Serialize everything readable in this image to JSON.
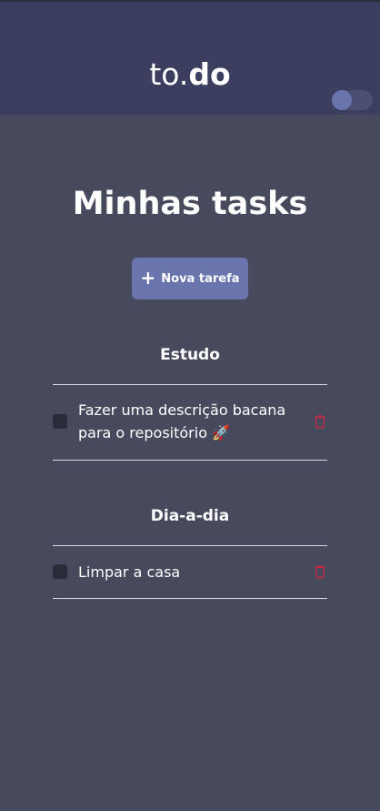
{
  "app": {
    "logo_light": "to.",
    "logo_bold": "do"
  },
  "theme_toggle": {
    "state": "on"
  },
  "page_title": "Minhas tasks",
  "new_task_button": {
    "icon": "plus-icon",
    "label": "Nova tarefa"
  },
  "sections": [
    {
      "title": "Estudo",
      "tasks": [
        {
          "text": "Fazer uma descrição bacana para o repositório 🚀",
          "completed": false
        }
      ]
    },
    {
      "title": "Dia-a-dia",
      "tasks": [
        {
          "text": "Limpar a casa",
          "completed": false
        }
      ]
    }
  ],
  "colors": {
    "header": "#3B3E5E",
    "background": "#474A5C",
    "accent": "#6A75AE",
    "checkbox": "#2A2C3A",
    "delete": "#C02845"
  }
}
